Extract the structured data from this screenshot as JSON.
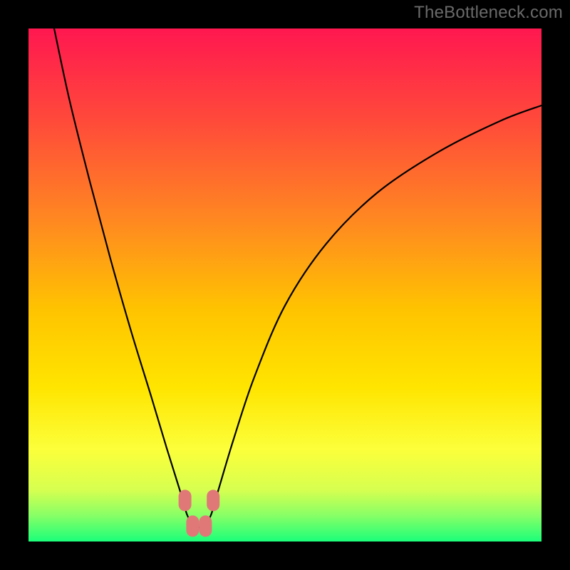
{
  "watermark": "TheBottleneck.com",
  "gradient": {
    "stops": [
      {
        "offset": 0.0,
        "color": "#ff1750"
      },
      {
        "offset": 0.18,
        "color": "#ff4a3a"
      },
      {
        "offset": 0.38,
        "color": "#ff8a20"
      },
      {
        "offset": 0.55,
        "color": "#ffc400"
      },
      {
        "offset": 0.7,
        "color": "#ffe500"
      },
      {
        "offset": 0.82,
        "color": "#fcff3a"
      },
      {
        "offset": 0.9,
        "color": "#d6ff50"
      },
      {
        "offset": 0.95,
        "color": "#86ff66"
      },
      {
        "offset": 1.0,
        "color": "#1bff7a"
      }
    ]
  },
  "chart_data": {
    "type": "line",
    "title": "",
    "xlabel": "",
    "ylabel": "",
    "xlim": [
      0,
      100
    ],
    "ylim": [
      0,
      100
    ],
    "legend": false,
    "grid": false,
    "series": [
      {
        "name": "bottleneck-curve",
        "x": [
          5,
          8,
          12,
          16,
          20,
          24,
          27,
          29.5,
          31,
          32.5,
          34,
          35.5,
          37,
          40,
          44,
          50,
          58,
          68,
          80,
          92,
          100
        ],
        "y": [
          100,
          86,
          70,
          55,
          41,
          28,
          18,
          10,
          5,
          3,
          3,
          5,
          10,
          20,
          32,
          46,
          58,
          68,
          76,
          82,
          85
        ]
      }
    ],
    "markers": [
      {
        "name": "dip-left-top",
        "x": 30.5,
        "y": 8
      },
      {
        "name": "dip-right-top",
        "x": 36.0,
        "y": 8
      },
      {
        "name": "dip-left-bot",
        "x": 32.0,
        "y": 3
      },
      {
        "name": "dip-right-bot",
        "x": 34.5,
        "y": 3
      }
    ]
  }
}
